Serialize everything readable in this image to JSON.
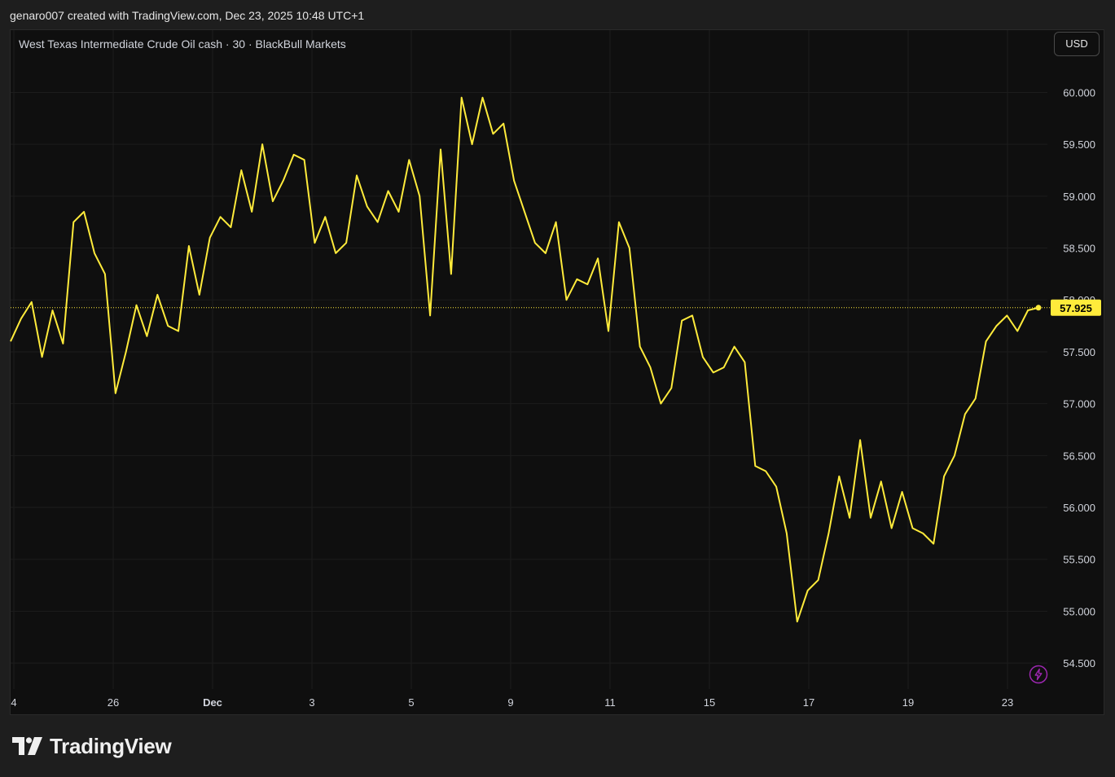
{
  "header": {
    "created_by": "genaro007 created with TradingView.com, Dec 23, 2025 10:48 UTC+1"
  },
  "symbol": {
    "title": "West Texas Intermediate Crude Oil cash · 30 · BlackBull Markets"
  },
  "currency": {
    "label": "USD"
  },
  "brand": {
    "name": "TradingView"
  },
  "icons": {
    "logo": "tradingview-logo-icon",
    "flash": "lightning-icon"
  },
  "colors": {
    "line": "#ffeb3b",
    "price_label_bg": "#ffeb3b",
    "price_label_text": "#000000",
    "flash": "#9c27b0"
  },
  "chart_data": {
    "type": "line",
    "ylim": [
      54.25,
      60.6
    ],
    "grid": true,
    "y_ticks": [
      "60.000",
      "59.500",
      "59.000",
      "58.500",
      "58.000",
      "57.500",
      "57.000",
      "56.500",
      "56.000",
      "55.500",
      "55.000",
      "54.500"
    ],
    "x_ticks": [
      "4",
      "26",
      "Dec",
      "3",
      "5",
      "9",
      "11",
      "15",
      "17",
      "19",
      "23"
    ],
    "last_value": 57.925,
    "last_value_label": "57.925",
    "series": [
      {
        "values": [
          57.6,
          57.82,
          57.98,
          57.45,
          57.9,
          57.58,
          58.75,
          58.85,
          58.45,
          58.25,
          57.1,
          57.5,
          57.95,
          57.65,
          58.05,
          57.75,
          57.7,
          58.52,
          58.05,
          58.6,
          58.8,
          58.7,
          59.25,
          58.85,
          59.5,
          58.95,
          59.15,
          59.4,
          59.35,
          58.55,
          58.8,
          58.45,
          58.55,
          59.2,
          58.9,
          58.75,
          59.05,
          58.85,
          59.35,
          59.0,
          57.85,
          59.45,
          58.25,
          59.95,
          59.5,
          59.95,
          59.6,
          59.7,
          59.15,
          58.85,
          58.55,
          58.45,
          58.75,
          58.0,
          58.2,
          58.15,
          58.4,
          57.7,
          58.75,
          58.5,
          57.55,
          57.35,
          57.0,
          57.15,
          57.8,
          57.85,
          57.45,
          57.3,
          57.35,
          57.55,
          57.4,
          56.4,
          56.35,
          56.2,
          55.75,
          54.9,
          55.2,
          55.3,
          55.75,
          56.3,
          55.9,
          56.65,
          55.9,
          56.25,
          55.8,
          56.15,
          55.8,
          55.75,
          55.65,
          56.3,
          56.5,
          56.9,
          57.05,
          57.6,
          57.75,
          57.85,
          57.7,
          57.9,
          57.925
        ]
      }
    ]
  }
}
